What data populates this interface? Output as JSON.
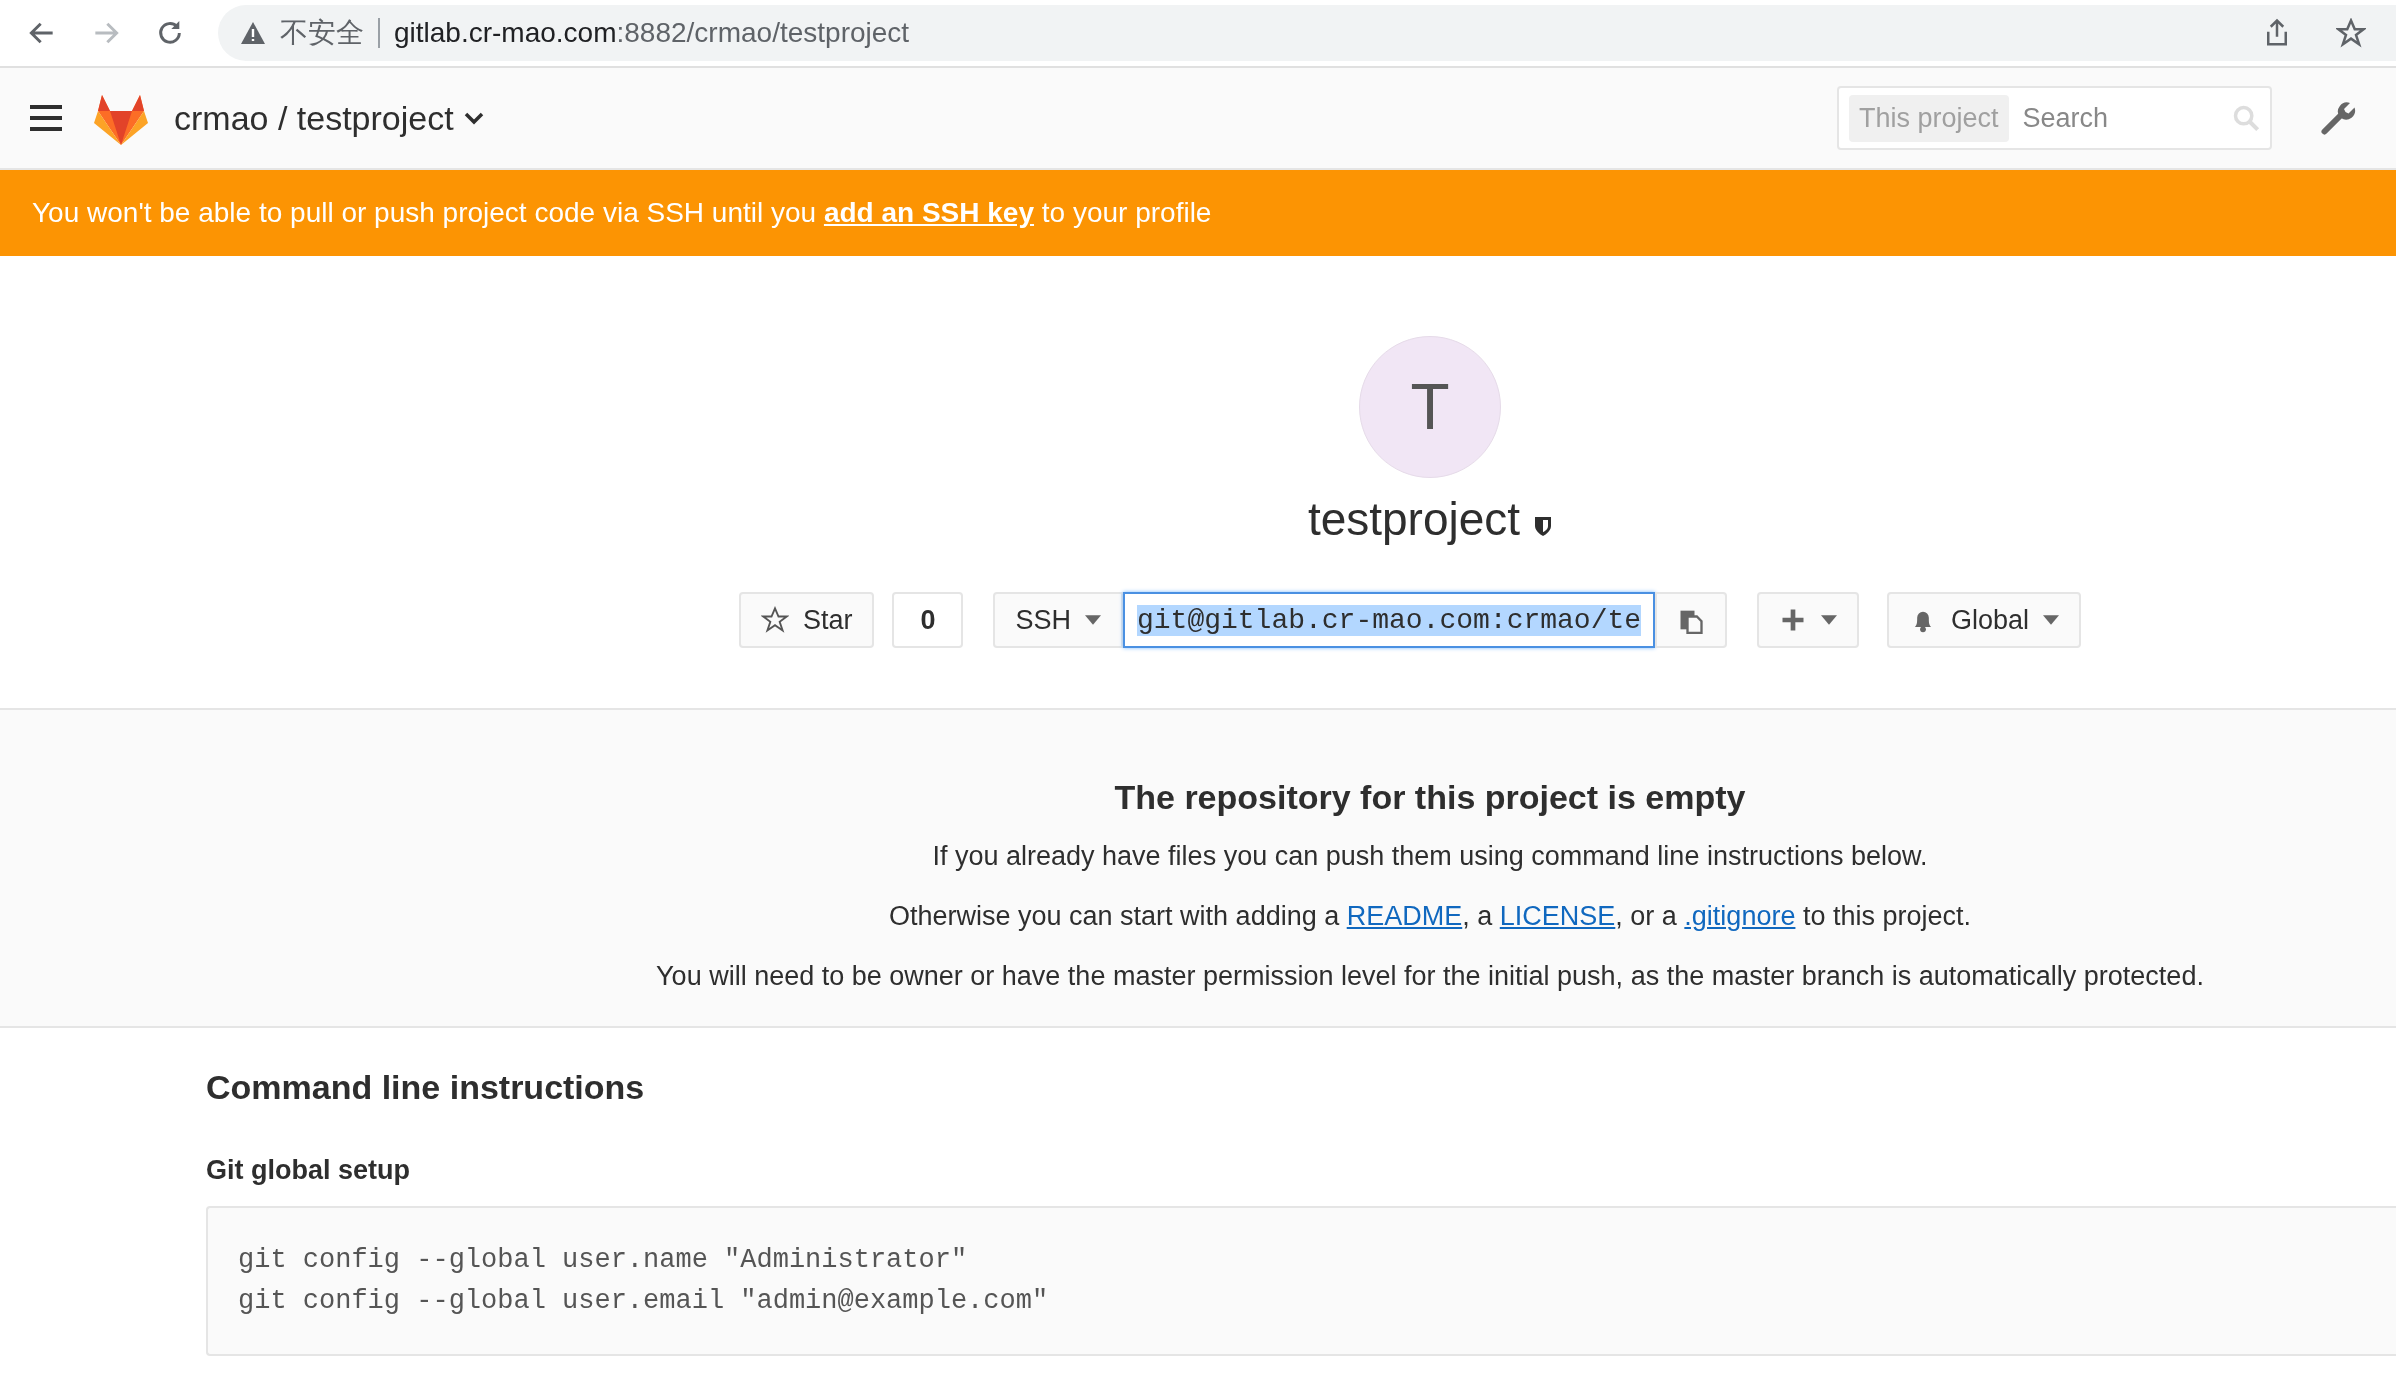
{
  "browser": {
    "security_label": "不安全",
    "url_host": "gitlab.cr-mao.com",
    "url_path": ":8882/crmao/testproject",
    "forward_disabled": true
  },
  "navbar": {
    "title": "crmao / testproject",
    "search": {
      "scope": "This project",
      "placeholder": "Search"
    }
  },
  "banner": {
    "parts": [
      {
        "kind": "text",
        "text": "You won't be able to pull or push project code via SSH until you "
      },
      {
        "kind": "link",
        "text": "add an SSH key"
      },
      {
        "kind": "text",
        "text": " to your profile"
      }
    ]
  },
  "project": {
    "avatar_letter": "T",
    "name": "testproject",
    "star_label": "Star",
    "star_count": "0",
    "protocol": "SSH",
    "clone_url": "git@gitlab.cr-mao.com:crmao/te",
    "notification": "Global"
  },
  "empty_repo": {
    "title": "The repository for this project is empty",
    "lines": [
      [
        {
          "kind": "text",
          "text": "If you already have files you can push them using command line instructions below."
        }
      ],
      [
        {
          "kind": "text",
          "text": "Otherwise you can start with adding a "
        },
        {
          "kind": "link",
          "text": "README"
        },
        {
          "kind": "text",
          "text": ", a "
        },
        {
          "kind": "link",
          "text": "LICENSE"
        },
        {
          "kind": "text",
          "text": ", or a "
        },
        {
          "kind": "link",
          "text": ".gitignore"
        },
        {
          "kind": "text",
          "text": " to this project."
        }
      ],
      [
        {
          "kind": "text",
          "text": "You will need to be owner or have the master permission level for the initial push, as the master branch is automatically protected."
        }
      ]
    ]
  },
  "commands": {
    "title": "Command line instructions",
    "sections": [
      {
        "title": "Git global setup",
        "code": [
          "git config --global user.name \"Administrator\"",
          "git config --global user.email \"admin@example.com\""
        ]
      }
    ]
  }
}
